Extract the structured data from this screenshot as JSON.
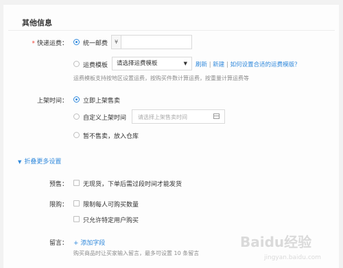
{
  "section": {
    "title": "其他信息"
  },
  "shipping": {
    "required_mark": "*",
    "label": "快递运费：",
    "option_unified": "统一邮费",
    "currency_prefix": "¥",
    "unified_value": "",
    "option_template": "运费模板",
    "template_select_value": "请选择运费模板",
    "refresh_link": "刷新",
    "divider1": "|",
    "new_link": "新建",
    "divider2": "|",
    "help_link": "如何设置合适的运费模版？",
    "hint": "运费模板支持按地区设置运费，按购买件数计算运费，按重量计算运费等"
  },
  "listing": {
    "label": "上架时间：",
    "option_now": "立即上架售卖",
    "option_custom": "自定义上架时间",
    "custom_placeholder": "请选择上架售卖时间",
    "option_warehouse": "暂不售卖，放入仓库"
  },
  "more_settings": {
    "toggle_label": "折叠更多设置"
  },
  "presale": {
    "label": "预售：",
    "option": "无现货，下单后需过段时间才能发货"
  },
  "purchase_limit": {
    "label": "限购：",
    "option_limit": "限制每人可购买数量",
    "option_specific": "只允许特定用户购买"
  },
  "message": {
    "label": "留言：",
    "add_field": "+ 添加字段",
    "hint": "购买商品时让买家输入留言，最多可设置 10 条留言"
  },
  "watermark": {
    "text": "Baidu经验",
    "url": "jingyan.baidu.com"
  }
}
